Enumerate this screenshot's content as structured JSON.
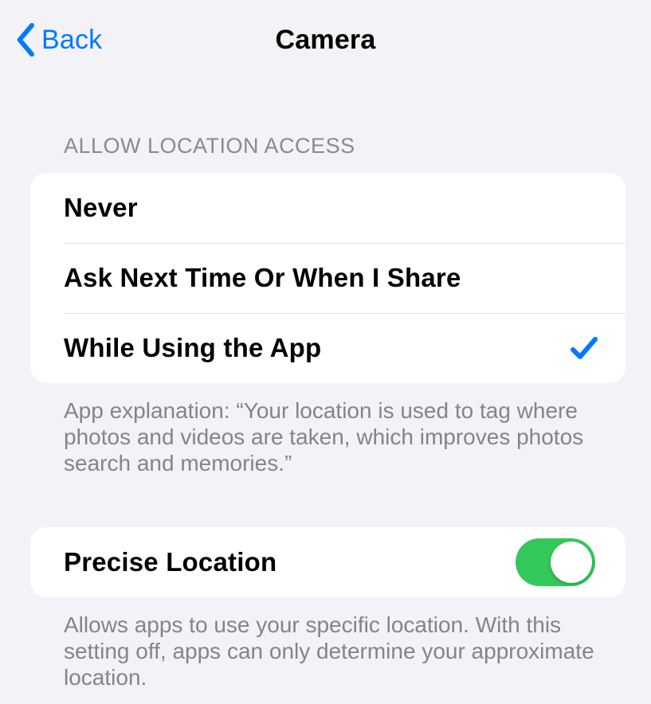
{
  "header": {
    "back_label": "Back",
    "title": "Camera"
  },
  "locationAccess": {
    "header": "Allow Location Access",
    "options": [
      {
        "label": "Never",
        "selected": false
      },
      {
        "label": "Ask Next Time Or When I Share",
        "selected": false
      },
      {
        "label": "While Using the App",
        "selected": true
      }
    ],
    "footer": "App explanation: “Your location is used to tag where photos and videos are taken, which improves photos search and memories.”"
  },
  "preciseLocation": {
    "label": "Precise Location",
    "enabled": true,
    "footer": "Allows apps to use your specific location. With this setting off, apps can only determine your approximate location."
  },
  "colors": {
    "link": "#007aff",
    "toggle_on": "#34c759"
  }
}
